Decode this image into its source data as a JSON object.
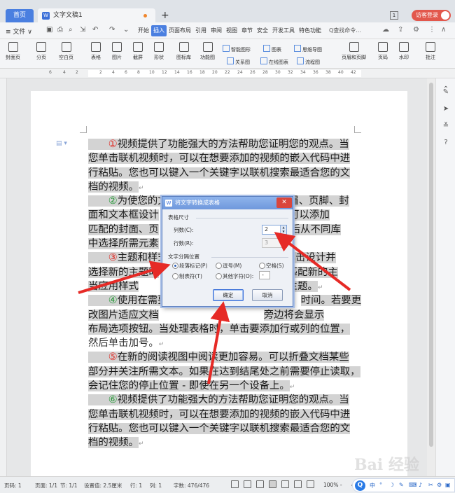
{
  "titlebar": {
    "home_tab": "首页",
    "doc_tab": "文字文稿1",
    "doc_tab_logo": "W",
    "new_tab": "+",
    "window_count": "1",
    "visitor_login": "访客登录"
  },
  "menubar": {
    "file": "≡ 文件 ∨",
    "menus": [
      "开始",
      "插入",
      "页面布局",
      "引用",
      "审阅",
      "视图",
      "章节",
      "安全",
      "开发工具",
      "特色功能"
    ],
    "active_menu": "插入",
    "search": "Q查找命令..."
  },
  "ribbon": {
    "items": [
      {
        "label": "封面页",
        "icon": "cover-page-icon"
      },
      {
        "label": "分页",
        "icon": "page-break-icon"
      },
      {
        "label": "空白页",
        "icon": "blank-page-icon"
      },
      {
        "label": "表格",
        "icon": "table-icon"
      },
      {
        "label": "图片",
        "icon": "picture-icon"
      },
      {
        "label": "截屏",
        "icon": "screenshot-icon"
      },
      {
        "label": "形状",
        "icon": "shape-icon"
      },
      {
        "label": "图标库",
        "icon": "icon-library-icon"
      },
      {
        "label": "功能图",
        "icon": "function-chart-icon"
      },
      {
        "label": "页眉和页脚",
        "icon": "header-footer-icon"
      },
      {
        "label": "页码",
        "icon": "page-number-icon"
      },
      {
        "label": "水印",
        "icon": "watermark-icon"
      },
      {
        "label": "批注",
        "icon": "comment-icon"
      }
    ],
    "small": [
      "智能图形",
      "图表",
      "思维导图",
      "关系图",
      "在线图表",
      "流程图"
    ]
  },
  "ruler": {
    "ticks": [
      "6",
      "4",
      "2",
      "2",
      "4",
      "6",
      "8",
      "10",
      "12",
      "14",
      "16",
      "18",
      "20",
      "22",
      "24",
      "26",
      "28",
      "30",
      "32",
      "34",
      "36",
      "38",
      "40",
      "42"
    ]
  },
  "document": {
    "paragraphs": [
      {
        "num": "①",
        "lines": [
          "视频提供了功能强大的方法帮助您证明您的观点。当",
          "您单击联机视频时，可以在想要添加的视频的嵌入代码中进",
          "行粘贴。您也可以键入一个关键字以联机搜索最适合您的文",
          "档的视频。"
        ]
      },
      {
        "num": "②",
        "lines": [
          "为使您的文档具有专业外观，提供了页眉、页脚、封",
          "面和文本框设计",
          "您可以添加",
          "匹配的封面、页",
          "后从不同库",
          "中选择所需元素"
        ]
      },
      {
        "num": "③",
        "lines": [
          "主题和样式",
          "单击设计并",
          "选择新的主题时",
          "匹配新的主",
          "当应用样式",
          "新的主题。"
        ]
      },
      {
        "num": "④",
        "lines": [
          "使用在需要",
          "时间。若要更",
          "改图片适应文档",
          "旁边将会显示",
          "布局选项按钮。当处理表格时，单击要添加行或列的位置，",
          "然后单击加号。"
        ]
      },
      {
        "num": "⑤",
        "lines": [
          "在新的阅读视图中阅读更加容易。可以折叠文档某些",
          "部分并关注所需文本。如果在达到结尾处之前需要停止读取，",
          "会记住您的停止位置 - 即使在另一个设备上。"
        ]
      },
      {
        "num": "⑥",
        "lines": [
          "视频提供了功能强大的方法帮助您证明您的观点。当",
          "您单击联机视频时，可以在想要添加的视频的嵌入代码中进",
          "行粘贴。您也可以键入一个关键字以联机搜索最适合您的文",
          "档的视频。"
        ]
      }
    ]
  },
  "dialog": {
    "title": "将文字转换成表格",
    "logo": "W",
    "close": "✕",
    "size_section": "表格尺寸",
    "columns_label": "列数(C):",
    "columns_value": "2",
    "rows_label": "行数(R):",
    "rows_value": "3",
    "separator_section": "文字分隔位置",
    "sep_paragraph": "段落标记(P)",
    "sep_comma": "逗号(M)",
    "sep_space": "空格(S)",
    "sep_tab": "制表符(T)",
    "sep_other": "其他字符(O):",
    "other_value": "-",
    "ok": "确定",
    "cancel": "取消"
  },
  "status": {
    "page": "页码: 1",
    "pages": "页面: 1/1",
    "section": "节: 1/1",
    "settings": "设置值: 2.5厘米",
    "row": "行: 1",
    "col": "列: 1",
    "words": "字数: 476/476",
    "zoom": "100% -"
  },
  "ime": {
    "logo": "Q",
    "lang": "中",
    "items": [
      "°",
      "☽",
      "✎",
      "⌨",
      "♪",
      "✂",
      "⚙",
      "▣"
    ]
  },
  "watermark": "Bai 经验"
}
